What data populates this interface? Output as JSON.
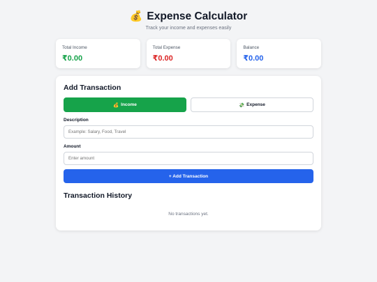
{
  "header": {
    "icon": "money-bag-icon",
    "icon_glyph": "💰",
    "title": "Expense Calculator",
    "subtitle": "Track your income and expenses easily"
  },
  "summary": {
    "income": {
      "label": "Total Income",
      "value": "₹0.00",
      "color": "#16a34a"
    },
    "expense": {
      "label": "Total Expense",
      "value": "₹0.00",
      "color": "#dc2626"
    },
    "balance": {
      "label": "Balance",
      "value": "₹0.00",
      "color": "#2563eb"
    }
  },
  "form": {
    "heading": "Add Transaction",
    "income_toggle": {
      "icon_glyph": "💰",
      "label": "Income",
      "selected": true
    },
    "expense_toggle": {
      "icon_glyph": "💸",
      "label": "Expense",
      "selected": false
    },
    "description_label": "Description",
    "description_placeholder": "Example: Salary, Food, Travel",
    "amount_label": "Amount",
    "amount_placeholder": "Enter amount",
    "submit_label": "+ Add Transaction"
  },
  "history": {
    "heading": "Transaction History",
    "empty_text": "No transactions yet."
  },
  "colors": {
    "accent_green": "#16a34a",
    "accent_blue": "#2563eb",
    "accent_red": "#dc2626",
    "background": "#f3f4f6"
  }
}
